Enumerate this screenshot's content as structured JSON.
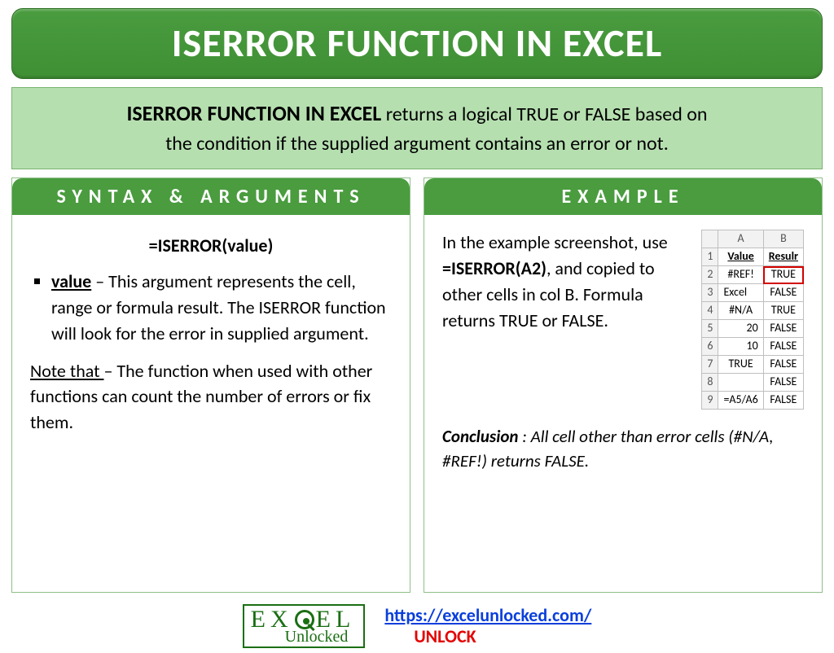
{
  "banner": {
    "title": "ISERROR FUNCTION IN EXCEL"
  },
  "desc": {
    "lead": "ISERROR FUNCTION IN EXCEL",
    "rest1": " returns a logical TRUE or FALSE based on ",
    "rest2": "the condition if the supplied argument contains an error or not."
  },
  "syntax": {
    "heading": "SYNTAX & ARGUMENTS",
    "formula": "=ISERROR(value)",
    "arg_name": "value",
    "arg_text": " – This argument represents the cell, range or formula result. The ISERROR function will look for the error in supplied argument.",
    "note_label": "Note that ",
    "note_text": "– The function when used with other functions can count the number of errors or fix them."
  },
  "example": {
    "heading": "EXAMPLE",
    "para_pre": "In the example screenshot, use ",
    "para_fx": "=ISERROR(A2)",
    "para_post": ", and copied to other cells in col B. Formula returns TRUE or FALSE.",
    "conclusion_label": "Conclusion",
    "conclusion_text": " : All cell other than error cells (#N/A, #REF!) returns FALSE."
  },
  "grid": {
    "columns": [
      "A",
      "B"
    ],
    "headers": {
      "A": "Value",
      "B": "Resulr"
    },
    "rows": [
      {
        "n": "2",
        "A": "#REF!",
        "B": "TRUE",
        "alignA": "center",
        "highlightB": true
      },
      {
        "n": "3",
        "A": "Excel",
        "B": "FALSE",
        "alignA": "left"
      },
      {
        "n": "4",
        "A": "#N/A",
        "B": "TRUE",
        "alignA": "center"
      },
      {
        "n": "5",
        "A": "20",
        "B": "FALSE",
        "alignA": "right"
      },
      {
        "n": "6",
        "A": "10",
        "B": "FALSE",
        "alignA": "right"
      },
      {
        "n": "7",
        "A": "TRUE",
        "B": "FALSE",
        "alignA": "center"
      },
      {
        "n": "8",
        "A": "",
        "B": "FALSE",
        "alignA": "center"
      },
      {
        "n": "9",
        "A": "=A5/A6",
        "B": "FALSE",
        "alignA": "left"
      }
    ]
  },
  "footer": {
    "logo_top": "EX  EL",
    "logo_bottom": "Unlocked",
    "url": "https://excelunlocked.com/",
    "unlock": "UNLOCK"
  }
}
